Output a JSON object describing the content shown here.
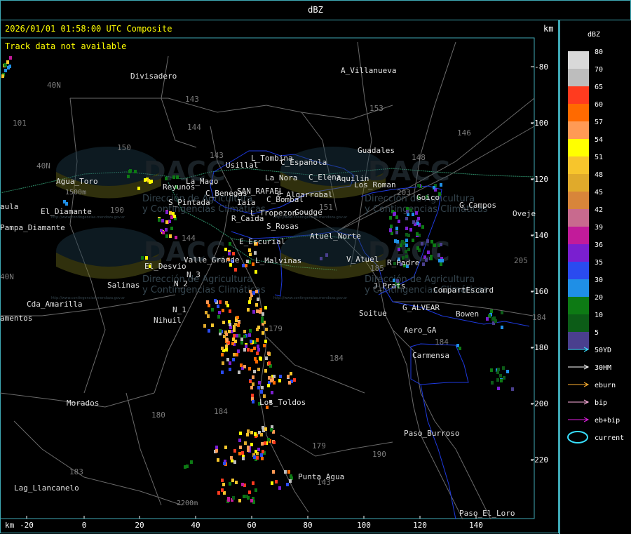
{
  "window": {
    "title": "dBZ"
  },
  "header": {
    "timestamp": "2026/01/01 01:58:00 UTC Composite",
    "notice": "Track data not available",
    "km_label": "km"
  },
  "axes": {
    "x_unit": "km",
    "x_ticks": [
      "-20",
      "0",
      "20",
      "40",
      "60",
      "80",
      "100",
      "120",
      "140"
    ],
    "y_unit": "km",
    "y_ticks": [
      "-80",
      "-100",
      "-120",
      "-140",
      "-160",
      "-180",
      "-200",
      "-220"
    ]
  },
  "places": [
    "Divisadero",
    "A_Villanueva",
    "Usillal",
    "L_Tombina",
    "C_Española",
    "C_Elena",
    "La_Nora",
    "Aquilin",
    "Los_Roman",
    "Agua_Toro",
    "Reyunos",
    "La_Mago",
    "S_Pintada",
    "C_Benegas",
    "SAN_RAFAEL",
    "C_Bombal",
    "E_Algarrobal",
    "R_Caida",
    "Iaia",
    "L_Tropezon",
    "Goudge",
    "S_Rosas",
    "Atuel_Norte",
    "E_Escurial",
    "Valle_Grande",
    "L_Malvinas",
    "El_Desvio",
    "Salinas",
    "N_2",
    "N_3",
    "N_1",
    "Nihuil",
    "V_Atuel",
    "R_Padre",
    "Goico",
    "G_Campos",
    "Oveje",
    "J_Prats",
    "CompartEscard",
    "G_ALVEAR",
    "Bowen",
    "Soitue",
    "Aero_GA",
    "Carmensa",
    "Cda_Amarilla",
    "amentos",
    "Pampa_Diamante",
    "El_Diamante",
    "aula",
    "Guadales",
    "Los_Toldos",
    "Morados",
    "Paso_Burroso",
    "Punta_Agua",
    "Lag_Llancanelo",
    "Paso_El_Loro",
    "1500m",
    "2200m",
    "40N",
    "40N",
    "101",
    "150",
    "143",
    "153",
    "146",
    "143",
    "144",
    "203",
    "190",
    "148",
    "151",
    "144",
    "184",
    "179",
    "180",
    "184",
    "183",
    "179",
    "143",
    "184",
    "190",
    "205",
    "185",
    "184",
    "40N"
  ],
  "watermark": {
    "logo": "DACC",
    "line1": "Dirección de Agricultura",
    "line2": "y Contingencias Climáticas",
    "url": "http://www.contingencias.mendoza.gov.ar"
  },
  "legend": {
    "title": "dBZ",
    "scale": [
      {
        "label": "80",
        "color": "#d9d9d9"
      },
      {
        "label": "70",
        "color": "#bdbdbd"
      },
      {
        "label": "65",
        "color": "#ff3b1f"
      },
      {
        "label": "60",
        "color": "#ff6a00"
      },
      {
        "label": "57",
        "color": "#ff9a55"
      },
      {
        "label": "54",
        "color": "#ffff00"
      },
      {
        "label": "51",
        "color": "#f7c52c"
      },
      {
        "label": "48",
        "color": "#e0aa2b"
      },
      {
        "label": "45",
        "color": "#d8853a"
      },
      {
        "label": "42",
        "color": "#c86a8e"
      },
      {
        "label": "39",
        "color": "#c21b9a"
      },
      {
        "label": "36",
        "color": "#7a1fd0"
      },
      {
        "label": "35",
        "color": "#2a4bf0"
      },
      {
        "label": "30",
        "color": "#1f8fe6"
      },
      {
        "label": "20",
        "color": "#0d7a14"
      },
      {
        "label": "10",
        "color": "#0c5c17"
      },
      {
        "label": "5",
        "color": "#4a3f8e"
      }
    ],
    "tracks": [
      {
        "label": "50YD",
        "color": "#38e0ff"
      },
      {
        "label": "30HM",
        "color": "#ffffff"
      },
      {
        "label": "eburn",
        "color": "#ffb030"
      },
      {
        "label": "bip",
        "color": "#ffb0e0"
      },
      {
        "label": "eb+bip",
        "color": "#e020e0"
      }
    ],
    "current_label": "current",
    "current_color": "#38e0ff"
  }
}
